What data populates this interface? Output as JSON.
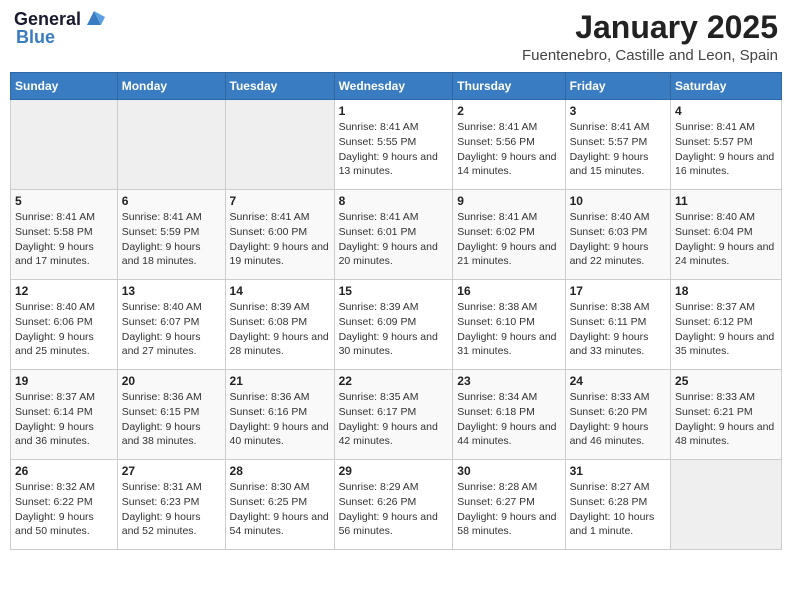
{
  "logo": {
    "line1": "General",
    "line2": "Blue"
  },
  "title": "January 2025",
  "subtitle": "Fuentenebro, Castille and Leon, Spain",
  "weekdays": [
    "Sunday",
    "Monday",
    "Tuesday",
    "Wednesday",
    "Thursday",
    "Friday",
    "Saturday"
  ],
  "weeks": [
    [
      {
        "day": "",
        "sunrise": "",
        "sunset": "",
        "daylight": ""
      },
      {
        "day": "",
        "sunrise": "",
        "sunset": "",
        "daylight": ""
      },
      {
        "day": "",
        "sunrise": "",
        "sunset": "",
        "daylight": ""
      },
      {
        "day": "1",
        "sunrise": "Sunrise: 8:41 AM",
        "sunset": "Sunset: 5:55 PM",
        "daylight": "Daylight: 9 hours and 13 minutes."
      },
      {
        "day": "2",
        "sunrise": "Sunrise: 8:41 AM",
        "sunset": "Sunset: 5:56 PM",
        "daylight": "Daylight: 9 hours and 14 minutes."
      },
      {
        "day": "3",
        "sunrise": "Sunrise: 8:41 AM",
        "sunset": "Sunset: 5:57 PM",
        "daylight": "Daylight: 9 hours and 15 minutes."
      },
      {
        "day": "4",
        "sunrise": "Sunrise: 8:41 AM",
        "sunset": "Sunset: 5:57 PM",
        "daylight": "Daylight: 9 hours and 16 minutes."
      }
    ],
    [
      {
        "day": "5",
        "sunrise": "Sunrise: 8:41 AM",
        "sunset": "Sunset: 5:58 PM",
        "daylight": "Daylight: 9 hours and 17 minutes."
      },
      {
        "day": "6",
        "sunrise": "Sunrise: 8:41 AM",
        "sunset": "Sunset: 5:59 PM",
        "daylight": "Daylight: 9 hours and 18 minutes."
      },
      {
        "day": "7",
        "sunrise": "Sunrise: 8:41 AM",
        "sunset": "Sunset: 6:00 PM",
        "daylight": "Daylight: 9 hours and 19 minutes."
      },
      {
        "day": "8",
        "sunrise": "Sunrise: 8:41 AM",
        "sunset": "Sunset: 6:01 PM",
        "daylight": "Daylight: 9 hours and 20 minutes."
      },
      {
        "day": "9",
        "sunrise": "Sunrise: 8:41 AM",
        "sunset": "Sunset: 6:02 PM",
        "daylight": "Daylight: 9 hours and 21 minutes."
      },
      {
        "day": "10",
        "sunrise": "Sunrise: 8:40 AM",
        "sunset": "Sunset: 6:03 PM",
        "daylight": "Daylight: 9 hours and 22 minutes."
      },
      {
        "day": "11",
        "sunrise": "Sunrise: 8:40 AM",
        "sunset": "Sunset: 6:04 PM",
        "daylight": "Daylight: 9 hours and 24 minutes."
      }
    ],
    [
      {
        "day": "12",
        "sunrise": "Sunrise: 8:40 AM",
        "sunset": "Sunset: 6:06 PM",
        "daylight": "Daylight: 9 hours and 25 minutes."
      },
      {
        "day": "13",
        "sunrise": "Sunrise: 8:40 AM",
        "sunset": "Sunset: 6:07 PM",
        "daylight": "Daylight: 9 hours and 27 minutes."
      },
      {
        "day": "14",
        "sunrise": "Sunrise: 8:39 AM",
        "sunset": "Sunset: 6:08 PM",
        "daylight": "Daylight: 9 hours and 28 minutes."
      },
      {
        "day": "15",
        "sunrise": "Sunrise: 8:39 AM",
        "sunset": "Sunset: 6:09 PM",
        "daylight": "Daylight: 9 hours and 30 minutes."
      },
      {
        "day": "16",
        "sunrise": "Sunrise: 8:38 AM",
        "sunset": "Sunset: 6:10 PM",
        "daylight": "Daylight: 9 hours and 31 minutes."
      },
      {
        "day": "17",
        "sunrise": "Sunrise: 8:38 AM",
        "sunset": "Sunset: 6:11 PM",
        "daylight": "Daylight: 9 hours and 33 minutes."
      },
      {
        "day": "18",
        "sunrise": "Sunrise: 8:37 AM",
        "sunset": "Sunset: 6:12 PM",
        "daylight": "Daylight: 9 hours and 35 minutes."
      }
    ],
    [
      {
        "day": "19",
        "sunrise": "Sunrise: 8:37 AM",
        "sunset": "Sunset: 6:14 PM",
        "daylight": "Daylight: 9 hours and 36 minutes."
      },
      {
        "day": "20",
        "sunrise": "Sunrise: 8:36 AM",
        "sunset": "Sunset: 6:15 PM",
        "daylight": "Daylight: 9 hours and 38 minutes."
      },
      {
        "day": "21",
        "sunrise": "Sunrise: 8:36 AM",
        "sunset": "Sunset: 6:16 PM",
        "daylight": "Daylight: 9 hours and 40 minutes."
      },
      {
        "day": "22",
        "sunrise": "Sunrise: 8:35 AM",
        "sunset": "Sunset: 6:17 PM",
        "daylight": "Daylight: 9 hours and 42 minutes."
      },
      {
        "day": "23",
        "sunrise": "Sunrise: 8:34 AM",
        "sunset": "Sunset: 6:18 PM",
        "daylight": "Daylight: 9 hours and 44 minutes."
      },
      {
        "day": "24",
        "sunrise": "Sunrise: 8:33 AM",
        "sunset": "Sunset: 6:20 PM",
        "daylight": "Daylight: 9 hours and 46 minutes."
      },
      {
        "day": "25",
        "sunrise": "Sunrise: 8:33 AM",
        "sunset": "Sunset: 6:21 PM",
        "daylight": "Daylight: 9 hours and 48 minutes."
      }
    ],
    [
      {
        "day": "26",
        "sunrise": "Sunrise: 8:32 AM",
        "sunset": "Sunset: 6:22 PM",
        "daylight": "Daylight: 9 hours and 50 minutes."
      },
      {
        "day": "27",
        "sunrise": "Sunrise: 8:31 AM",
        "sunset": "Sunset: 6:23 PM",
        "daylight": "Daylight: 9 hours and 52 minutes."
      },
      {
        "day": "28",
        "sunrise": "Sunrise: 8:30 AM",
        "sunset": "Sunset: 6:25 PM",
        "daylight": "Daylight: 9 hours and 54 minutes."
      },
      {
        "day": "29",
        "sunrise": "Sunrise: 8:29 AM",
        "sunset": "Sunset: 6:26 PM",
        "daylight": "Daylight: 9 hours and 56 minutes."
      },
      {
        "day": "30",
        "sunrise": "Sunrise: 8:28 AM",
        "sunset": "Sunset: 6:27 PM",
        "daylight": "Daylight: 9 hours and 58 minutes."
      },
      {
        "day": "31",
        "sunrise": "Sunrise: 8:27 AM",
        "sunset": "Sunset: 6:28 PM",
        "daylight": "Daylight: 10 hours and 1 minute."
      },
      {
        "day": "",
        "sunrise": "",
        "sunset": "",
        "daylight": ""
      }
    ]
  ]
}
